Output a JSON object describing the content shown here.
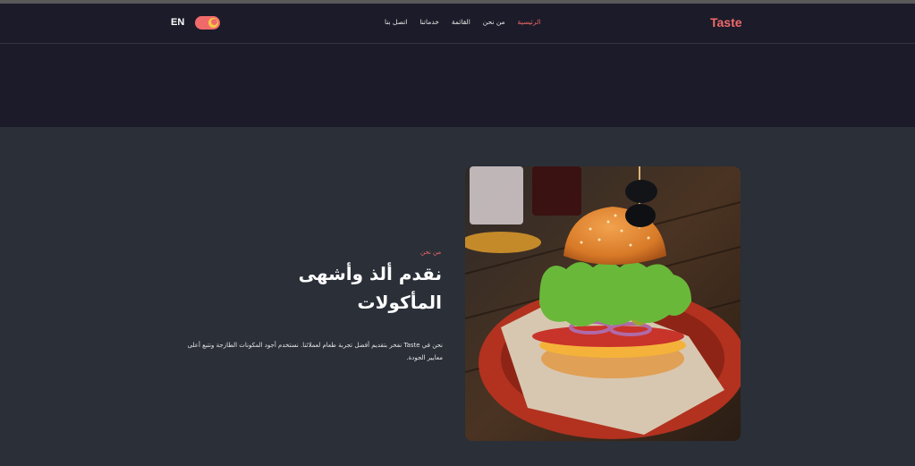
{
  "navbar": {
    "lang_label": "EN",
    "brand": "Taste",
    "links": [
      {
        "label": "الرئيسية",
        "active": true
      },
      {
        "label": "من نحن",
        "active": false
      },
      {
        "label": "القائمة",
        "active": false
      },
      {
        "label": "خدماتنا",
        "active": false
      },
      {
        "label": "اتصل بنا",
        "active": false
      }
    ]
  },
  "about": {
    "tag": "من نحن",
    "title_line1": "نقدم ألذ وأشهى",
    "title_line2": "المأكولات",
    "paragraph": "نحن في Taste نفخر بتقديم أفضل تجربة طعام لعملائنا. نستخدم أجود المكونات الطازجة ونتبع أعلى معايير الجودة."
  },
  "colors": {
    "accent": "#f06a6a",
    "nav_bg": "#1c1b29",
    "page_bg": "#2a2f38"
  }
}
